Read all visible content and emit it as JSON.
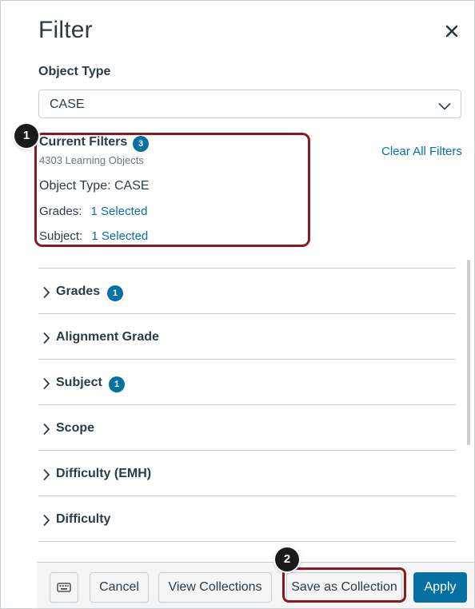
{
  "header": {
    "title": "Filter"
  },
  "object_type": {
    "label": "Object Type",
    "selected": "CASE"
  },
  "current_filters": {
    "title": "Current Filters",
    "count": "3",
    "learning_objects": "4303 Learning Objects",
    "object_type_line": "Object Type: CASE",
    "grades_label": "Grades:",
    "grades_value": "1 Selected",
    "subject_label": "Subject:",
    "subject_value": "1 Selected",
    "clear_all": "Clear All Filters"
  },
  "callouts": {
    "first": "1",
    "second": "2"
  },
  "accordion": [
    {
      "label": "Grades",
      "badge": "1"
    },
    {
      "label": "Alignment Grade",
      "badge": ""
    },
    {
      "label": "Subject",
      "badge": "1"
    },
    {
      "label": "Scope",
      "badge": ""
    },
    {
      "label": "Difficulty (EMH)",
      "badge": ""
    },
    {
      "label": "Difficulty",
      "badge": ""
    },
    {
      "label": "",
      "badge": ""
    }
  ],
  "footer": {
    "cancel": "Cancel",
    "view_collections": "View Collections",
    "save_as_collection": "Save as Collection",
    "apply": "Apply"
  },
  "colors": {
    "accent": "#0770a3",
    "callout_border": "#8b1a1e",
    "text": "#2d3b45"
  },
  "icons": {
    "close": "close-icon",
    "chevron": "chevron-down-icon",
    "caret": "chevron-right-icon",
    "keyboard": "keyboard-icon"
  }
}
